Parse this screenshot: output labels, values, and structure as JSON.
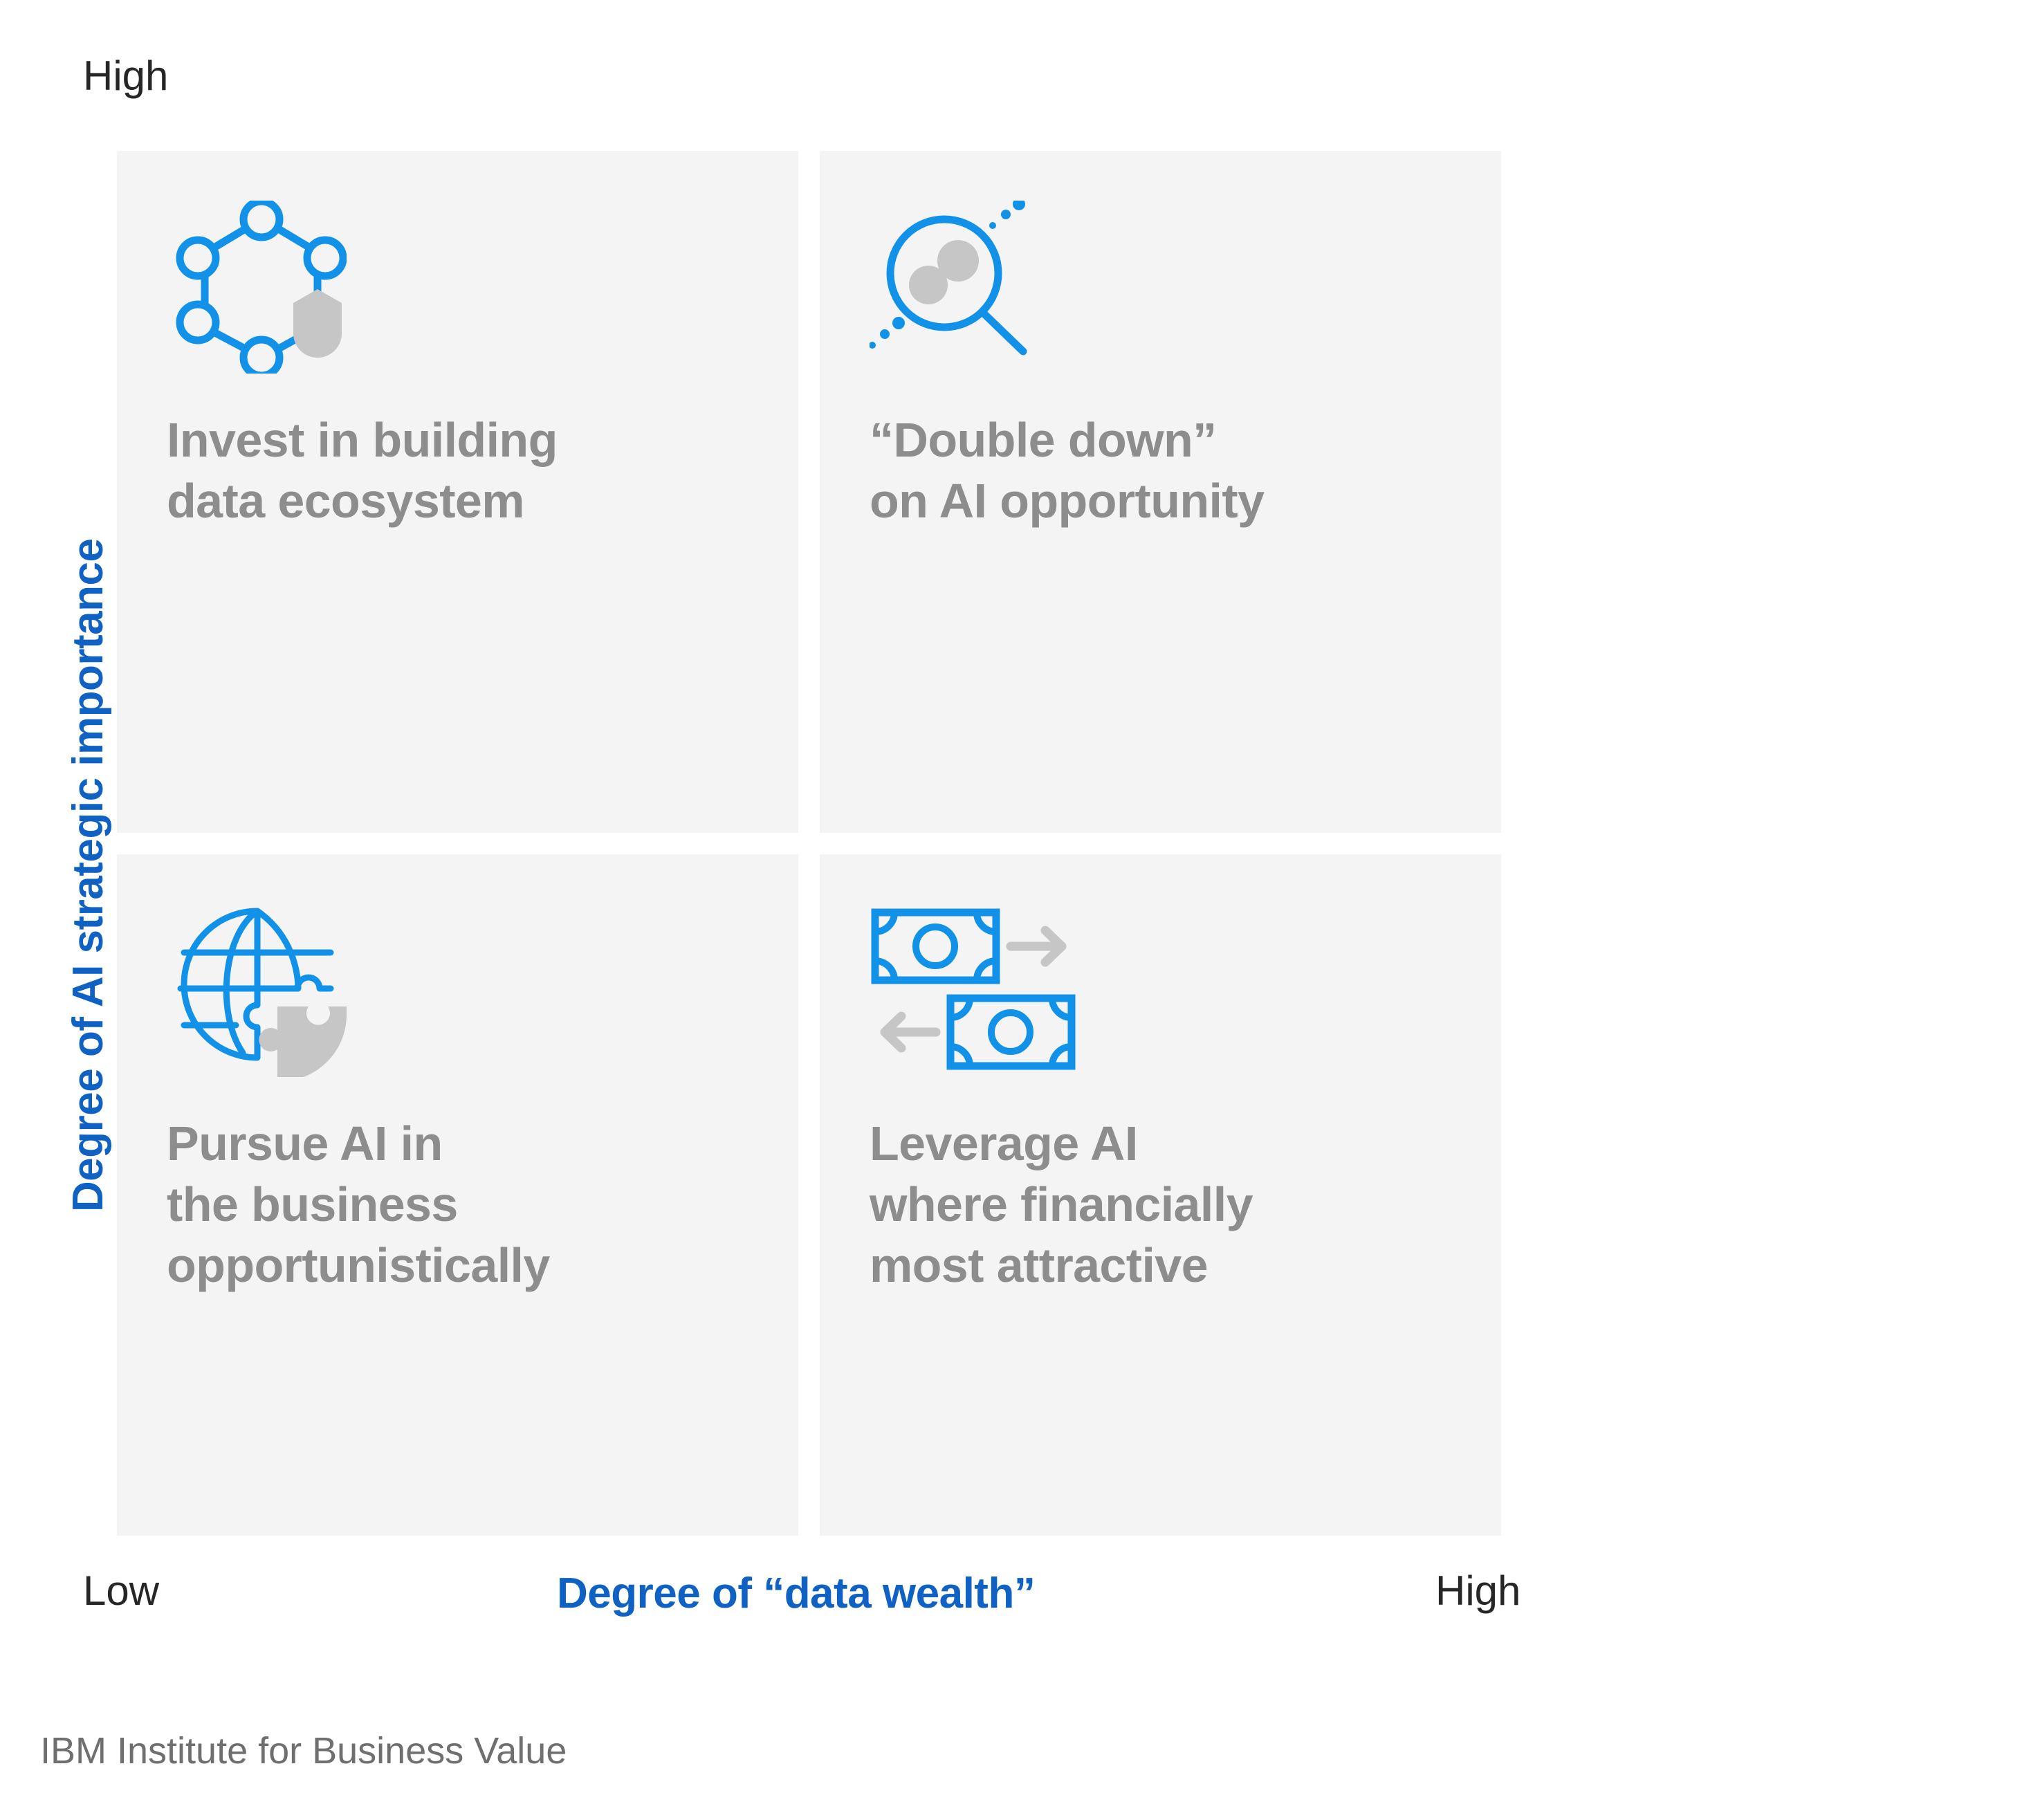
{
  "axes": {
    "y_title": "Degree of AI strategic importance",
    "y_top_label": "High",
    "x_title": "Degree of “data wealth”",
    "x_left_label": "Low",
    "x_right_label": "High"
  },
  "quadrants": [
    {
      "id": "top-left",
      "icon": "network-hexagon-shield-icon",
      "label": "Invest in building\ndata ecosystem"
    },
    {
      "id": "top-right",
      "icon": "magnifying-glass-data-icon",
      "label": "“Double down”\non AI opportunity"
    },
    {
      "id": "bottom-left",
      "icon": "globe-puzzle-icon",
      "label": "Pursue AI in\nthe business\nopportunistically"
    },
    {
      "id": "bottom-right",
      "icon": "banknote-exchange-icon",
      "label": "Leverage AI\nwhere financially\nmost attractive"
    }
  ],
  "footer": {
    "source": "IBM Institute for Business Value"
  },
  "colors": {
    "accent_blue": "#1192e8",
    "axis_blue": "#0f62c3",
    "quadrant_bg": "#f4f4f4",
    "label_gray": "#8d8d8d",
    "icon_gray": "#c6c6c6",
    "text_dark": "#262626",
    "footer_gray": "#6f6f6f"
  },
  "chart_data": {
    "type": "table",
    "title": "AI strategic importance vs. data wealth matrix",
    "xlabel": "Degree of “data wealth”",
    "ylabel": "Degree of AI strategic importance",
    "x_ticks": [
      "Low",
      "High"
    ],
    "y_ticks": [
      "High"
    ],
    "grid": false,
    "legend": "none",
    "categories": [
      "top-left",
      "top-right",
      "bottom-left",
      "bottom-right"
    ],
    "cells": [
      {
        "x": "Low",
        "y": "High",
        "label": "Invest in building data ecosystem"
      },
      {
        "x": "High",
        "y": "High",
        "label": "“Double down” on AI opportunity"
      },
      {
        "x": "Low",
        "y": "Low",
        "label": "Pursue AI in the business opportunistically"
      },
      {
        "x": "High",
        "y": "Low",
        "label": "Leverage AI where financially most attractive"
      }
    ]
  }
}
